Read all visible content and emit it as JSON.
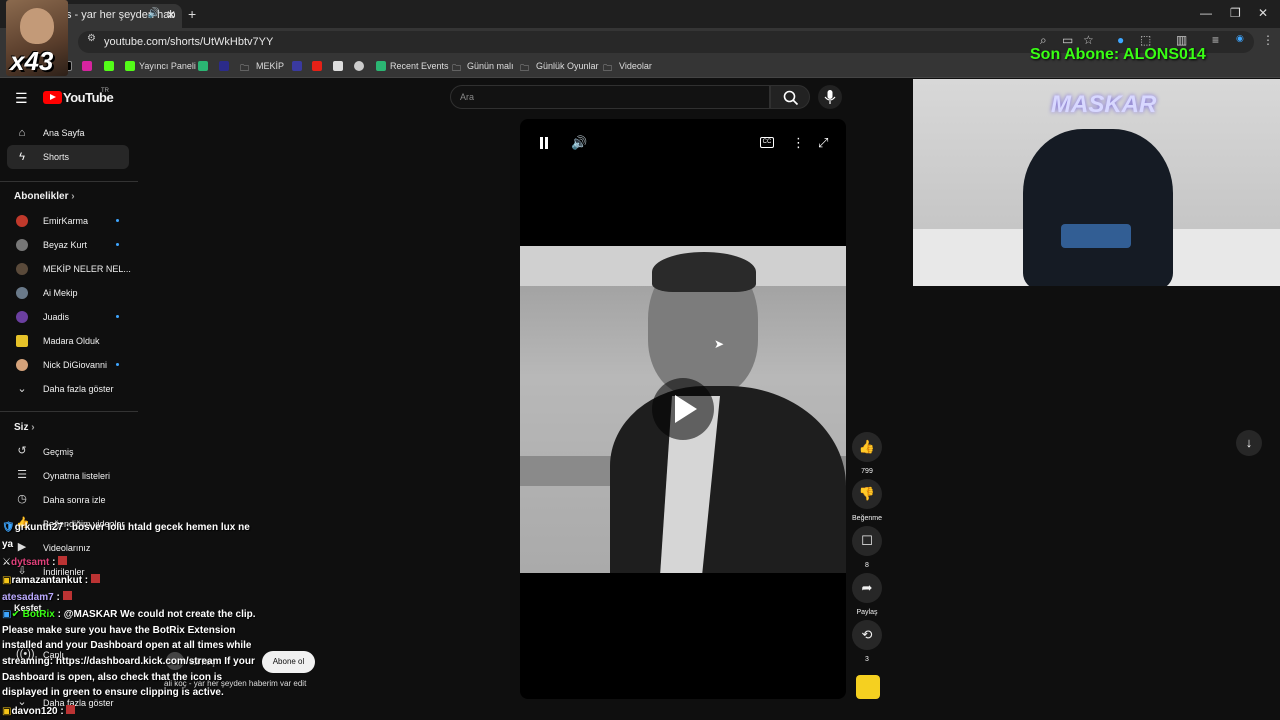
{
  "browser": {
    "tab_title": "s - yar her şeyden hab",
    "url": "youtube.com/shorts/UtWkHbtv7YY",
    "bookmarks": [
      "Yayıncı Paneli",
      "MEKİP",
      "Recent Events",
      "Günün malı",
      "Günlük Oyunlar",
      "Videolar"
    ]
  },
  "overlay": {
    "multiplier": "x43",
    "son_abone": "Son Abone: ALONS014",
    "cam_label": "MASKAR"
  },
  "youtube": {
    "logo": "YouTube",
    "region": "TR",
    "search_placeholder": "Ara",
    "nav": {
      "home": "Ana Sayfa",
      "shorts": "Shorts"
    },
    "subscriptions_header": "Abonelikler",
    "subscriptions": [
      {
        "name": "EmirKarma",
        "color": "#c0392b",
        "new": true
      },
      {
        "name": "Beyaz Kurt",
        "color": "#777777",
        "new": true
      },
      {
        "name": "MEKİP NELER NEL...",
        "color": "#5a4a3a",
        "new": false
      },
      {
        "name": "Ai Mekip",
        "color": "#6a7a8a",
        "new": false
      },
      {
        "name": "Juadis",
        "color": "#6b3fa0",
        "new": true
      },
      {
        "name": "Madara Olduk",
        "color": "#e6c229",
        "new": false
      },
      {
        "name": "Nick DiGiovanni",
        "color": "#d4a27a",
        "new": true
      }
    ],
    "show_more": "Daha fazla göster",
    "you_header": "Siz",
    "you_items": [
      "Geçmiş",
      "Oynatma listeleri",
      "Daha sonra izle",
      "Beğendiğim videolar",
      "Videolarınız",
      "İndirilenler"
    ],
    "explore_header": "Keşfet",
    "explore_items": [
      "Canlı"
    ],
    "show_more_2": "Daha fazla göster",
    "video": {
      "likes": "799",
      "dislike_label": "Beğenme",
      "comments": "8",
      "share_label": "Paylaş",
      "remix_count": "3",
      "channel": "ali koç",
      "subscribe": "Abone ol",
      "title": "ali koç - yar her şeyden haberim var edit"
    }
  },
  "chat": [
    {
      "user": "grkuntn27",
      "msg": " : bosver lolu htald gecek hemen lux ne",
      "color": "#ffffff"
    },
    {
      "user": "",
      "msg": "ya",
      "color": "#ffffff"
    },
    {
      "user": "dytsamt",
      "msg": " :",
      "color": "#e0407a"
    },
    {
      "user": "ramazantankut",
      "msg": " :",
      "color": "#ffffff"
    },
    {
      "user": "atesadam7",
      "msg": " :",
      "color": "#ffffff"
    },
    {
      "user": "BotRix",
      "msg": " : @MASKAR We could not create the clip.",
      "color": "#39ff14"
    },
    {
      "user": "",
      "msg": "Please make sure you have the BotRix Extension",
      "color": "#ffffff"
    },
    {
      "user": "",
      "msg": "installed and your Dashboard open at all times while",
      "color": "#ffffff"
    },
    {
      "user": "",
      "msg": "streaming: https://dashboard.kick.com/stream If your",
      "color": "#ffffff"
    },
    {
      "user": "",
      "msg": "Dashboard is open, also check that the  icon is",
      "color": "#ffffff"
    },
    {
      "user": "",
      "msg": "displayed in green to ensure clipping is active.",
      "color": "#ffffff"
    },
    {
      "user": "davon120",
      "msg": " :",
      "color": "#ffffff"
    }
  ]
}
